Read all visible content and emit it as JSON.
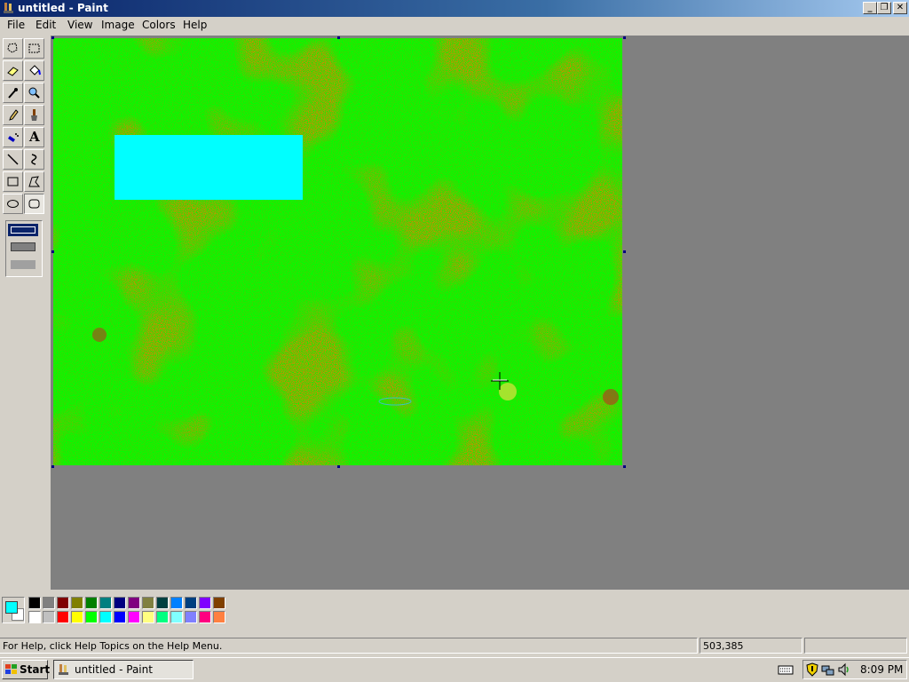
{
  "window": {
    "title": "untitled - Paint"
  },
  "menu": [
    "File",
    "Edit",
    "View",
    "Image",
    "Colors",
    "Help"
  ],
  "tools": [
    {
      "name": "free-form-select-icon"
    },
    {
      "name": "select-icon"
    },
    {
      "name": "eraser-icon"
    },
    {
      "name": "fill-bucket-icon"
    },
    {
      "name": "color-picker-icon"
    },
    {
      "name": "magnifier-icon"
    },
    {
      "name": "pencil-icon"
    },
    {
      "name": "brush-icon"
    },
    {
      "name": "airbrush-icon"
    },
    {
      "name": "text-icon"
    },
    {
      "name": "line-icon"
    },
    {
      "name": "curve-icon"
    },
    {
      "name": "rectangle-icon"
    },
    {
      "name": "polygon-icon"
    },
    {
      "name": "ellipse-icon"
    },
    {
      "name": "rounded-rectangle-icon"
    }
  ],
  "text_tool_glyph": "A",
  "colors": {
    "canvas": "#00ff00",
    "rectangle_fill": "#00ffff",
    "foreground": "#00ffff",
    "background": "#ffffff"
  },
  "palette": [
    "#000000",
    "#808080",
    "#800000",
    "#808000",
    "#008000",
    "#008080",
    "#000080",
    "#800080",
    "#808040",
    "#004040",
    "#0080ff",
    "#004080",
    "#8000ff",
    "#804000",
    "#ffffff",
    "#c0c0c0",
    "#ff0000",
    "#ffff00",
    "#00ff00",
    "#00ffff",
    "#0000ff",
    "#ff00ff",
    "#ffff80",
    "#00ff80",
    "#80ffff",
    "#8080ff",
    "#ff0080",
    "#ff8040"
  ],
  "status": {
    "help_text": "For Help, click Help Topics on the Help Menu.",
    "coordinates": "503,385",
    "size": ""
  },
  "taskbar": {
    "start_label": "Start",
    "task_label": "untitled - Paint",
    "clock": "8:09 PM"
  }
}
